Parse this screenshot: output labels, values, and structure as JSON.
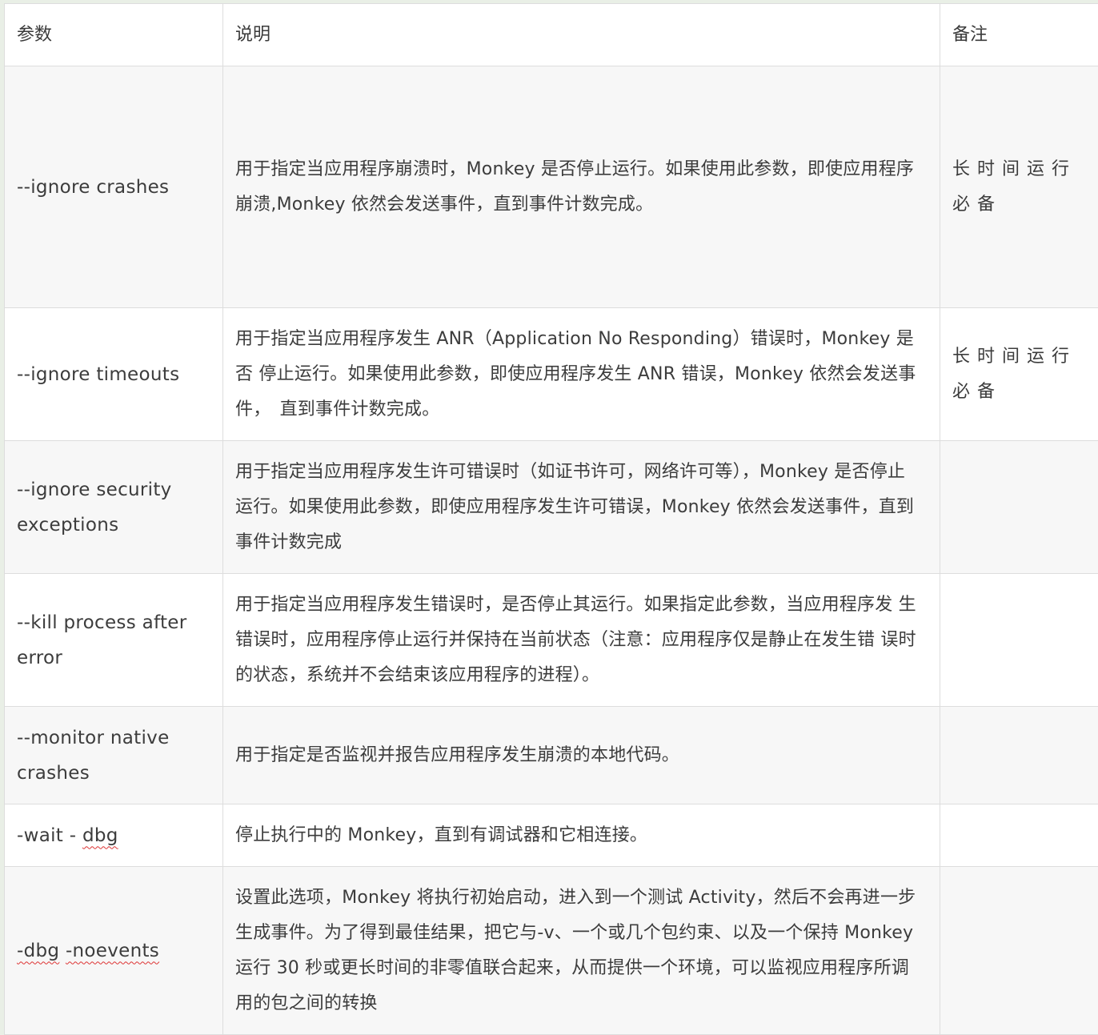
{
  "table": {
    "headers": [
      "参数",
      "说明",
      "备注"
    ],
    "rows": [
      {
        "param": "--ignore crashes",
        "desc": "用于指定当应用程序崩溃时，Monkey 是否停止运行。如果使用此参数，即使应用程序 崩溃,Monkey 依然会发送事件，直到事件计数完成。",
        "note": "长时间运行必备"
      },
      {
        "param": "--ignore timeouts",
        "desc": "用于指定当应用程序发生 ANR（Application No Responding）错误时，Monkey 是否 停止运行。如果使用此参数，即使应用程序发生 ANR 错误，Monkey 依然会发送事件，　直到事件计数完成。",
        "note": "长时间运行必备"
      },
      {
        "param": "--ignore security exceptions",
        "desc": "用于指定当应用程序发生许可错误时（如证书许可，网络许可等），Monkey 是否停止 运行。如果使用此参数，即使应用程序发生许可错误，Monkey 依然会发送事件，直到 事件计数完成",
        "note": ""
      },
      {
        "param": "--kill process after error",
        "desc": "用于指定当应用程序发生错误时，是否停止其运行。如果指定此参数，当应用程序发 生错误时，应用程序停止运行并保持在当前状态（注意：应用程序仅是静止在发生错 误时的状态，系统并不会结束该应用程序的进程）。",
        "note": ""
      },
      {
        "param": "--monitor native crashes",
        "desc": "用于指定是否监视并报告应用程序发生崩溃的本地代码。",
        "note": ""
      },
      {
        "param_prefix": "-wait - ",
        "param_flagged": "dbg",
        "desc": "停止执行中的 Monkey，直到有调试器和它相连接。",
        "note": ""
      },
      {
        "param_flagged": "-dbg",
        "param_gap": " ",
        "param_flagged2": "-noevents",
        "desc": "设置此选项，Monkey 将执行初始启动，进入到一个测试 Activity，然后不会再进一步 生成事件。为了得到最佳结果，把它与-v、一个或几个包约束、以及一个保持 Monkey 运行 30 秒或更长时间的非零值联合起来，从而提供一个环境，可以监视应用程序所调 用的包之间的转换",
        "note": ""
      }
    ]
  }
}
